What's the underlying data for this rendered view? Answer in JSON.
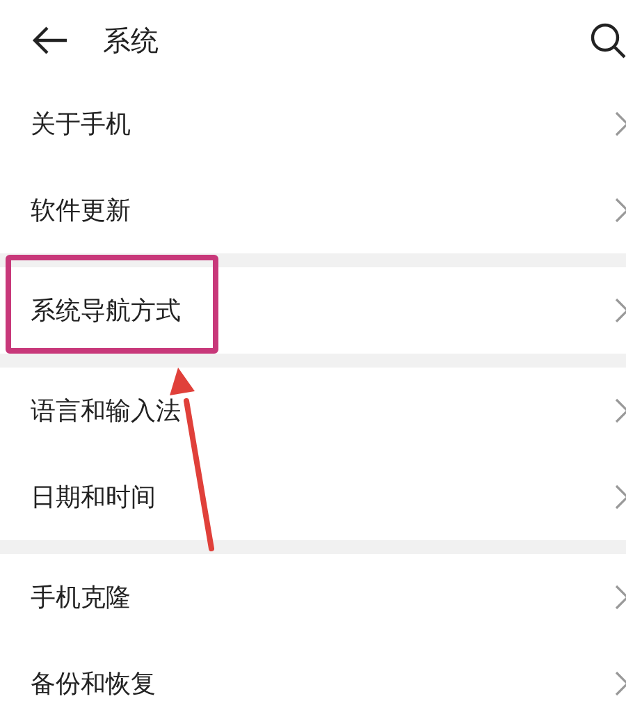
{
  "header": {
    "title": "系统"
  },
  "sections": [
    {
      "items": [
        {
          "label": "关于手机",
          "highlighted": false
        },
        {
          "label": "软件更新",
          "highlighted": false
        }
      ]
    },
    {
      "items": [
        {
          "label": "系统导航方式",
          "highlighted": true
        }
      ]
    },
    {
      "items": [
        {
          "label": "语言和输入法",
          "highlighted": false
        },
        {
          "label": "日期和时间",
          "highlighted": false
        }
      ]
    },
    {
      "items": [
        {
          "label": "手机克隆",
          "highlighted": false
        },
        {
          "label": "备份和恢复",
          "highlighted": false
        }
      ]
    }
  ]
}
